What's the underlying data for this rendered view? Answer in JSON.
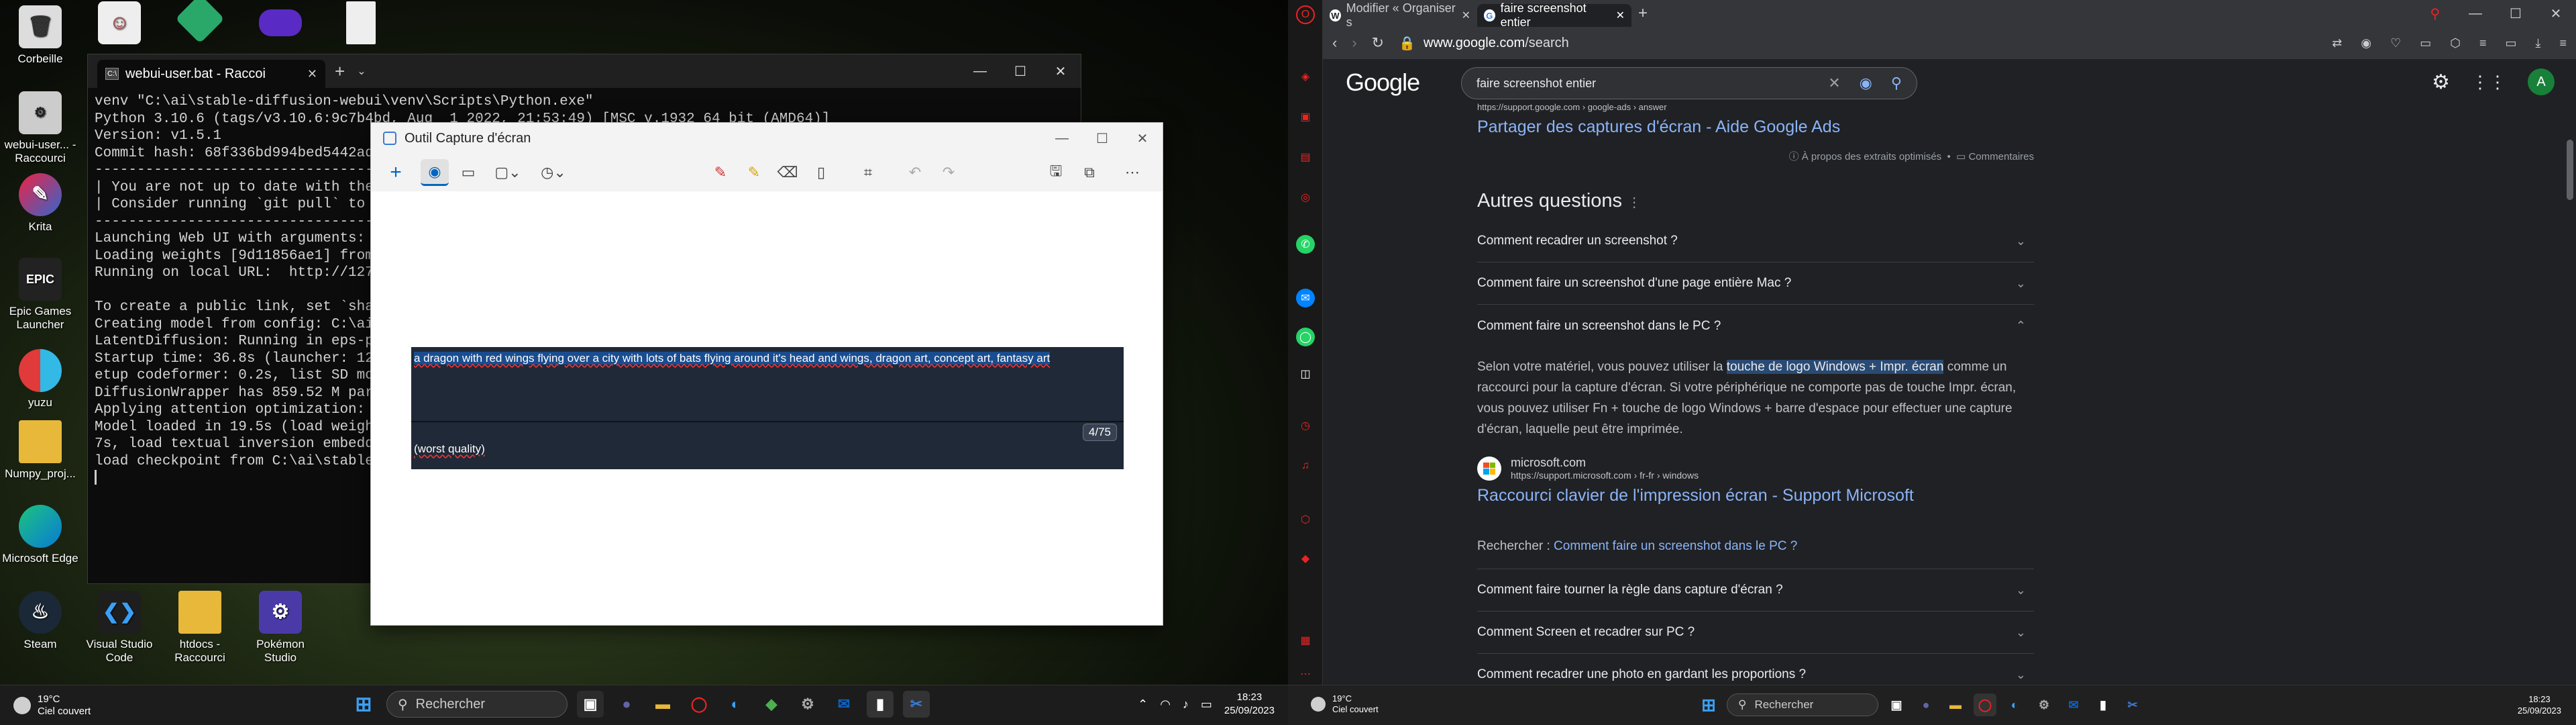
{
  "desktop": {
    "icons": [
      {
        "label": "Corbeille"
      },
      {
        "label": "webui-user... - Raccourci"
      },
      {
        "label": "Krita"
      },
      {
        "label": "Epic Games Launcher"
      },
      {
        "label": "yuzu"
      },
      {
        "label": "Numpy_proj..."
      },
      {
        "label": "Microsoft Edge"
      }
    ],
    "bottom_icons": [
      {
        "label": "Steam"
      },
      {
        "label": "Visual Studio Code"
      },
      {
        "label": "htdocs - Raccourci"
      },
      {
        "label": "Pokémon Studio"
      }
    ]
  },
  "terminal": {
    "tab_title": "webui-user.bat - Raccoi",
    "lines": [
      "venv \"C:\\ai\\stable-diffusion-webui\\venv\\Scripts\\Python.exe\"",
      "Python 3.10.6 (tags/v3.10.6:9c7b4bd, Aug  1 2022, 21:53:49) [MSC v.1932 64 bit (AMD64)]",
      "Version: v1.5.1",
      "Commit hash: 68f336bd994bed5442ad9",
      "--------------------------------------",
      "| You are not up to date with the m",
      "| Consider running `git pull` to up",
      "--------------------------------------",
      "Launching Web UI with arguments: --",
      "Loading weights [9d11856ae1] from C",
      "Running on local URL:  http://127.0",
      "",
      "To create a public link, set `share",
      "Creating model from config: C:\\ai\\",
      "LatentDiffusion: Running in eps-pre",
      "Startup time: 36.8s (launcher: 12.",
      "etup codeformer: 0.2s, list SD mode",
      "DiffusionWrapper has 859.52 M param",
      "Applying attention optimization: x",
      "Model loaded in 19.5s (load weights",
      "7s, load textual inversion embeddin",
      "load checkpoint from C:\\ai\\stable-"
    ]
  },
  "snip": {
    "title": "Outil Capture d'écran",
    "prompt": "a dragon with red wings flying over a city with lots of bats flying around it's head and wings, dragon art, concept art, fantasy art",
    "counter": "4/75",
    "negative": "(worst quality)"
  },
  "taskbar_left": {
    "temp": "19°C",
    "weather": "Ciel couvert",
    "search": "Rechercher",
    "time": "18:23",
    "date": "25/09/2023"
  },
  "browser": {
    "tabs": [
      {
        "title": "Modifier « Organiser s"
      },
      {
        "title": "faire screenshot entier"
      }
    ],
    "url_domain": "www.google.com",
    "url_path": "/search",
    "query": "faire screenshot entier",
    "top_cite": "https://support.google.com › google-ads › answer",
    "top_link": "Partager des captures d'écran - Aide Google Ads",
    "about_snippets": "À propos des extraits optimisés",
    "comments": "Commentaires",
    "aq_title": "Autres questions",
    "questions": [
      "Comment recadrer un screenshot ?",
      "Comment faire un screenshot d'une page entière Mac ?",
      "Comment faire un screenshot dans le PC ?"
    ],
    "answer_pre": "Selon votre matériel, vous pouvez utiliser la ",
    "answer_mark": "touche de logo Windows + Impr. écran",
    "answer_post": " comme un raccourci pour la capture d'écran. Si votre périphérique ne comporte pas de touche Impr. écran, vous pouvez utiliser Fn + touche de logo Windows + barre d'espace pour effectuer une capture d'écran, laquelle peut être imprimée.",
    "source_name": "microsoft.com",
    "source_cite": "https://support.microsoft.com › fr-fr › windows",
    "source_link": "Raccourci clavier de l'impression écran - Support Microsoft",
    "search_more_label": "Rechercher : ",
    "search_more_link": "Comment faire un screenshot dans le PC ?",
    "more_questions": [
      "Comment faire tourner la règle dans capture d'écran ?",
      "Comment Screen et recadrer sur PC ?",
      "Comment recadrer une photo en gardant les proportions ?"
    ]
  },
  "taskbar_right": {
    "temp": "19°C",
    "weather": "Ciel couvert",
    "search": "Rechercher",
    "time": "18:23",
    "date": "25/09/2023"
  }
}
